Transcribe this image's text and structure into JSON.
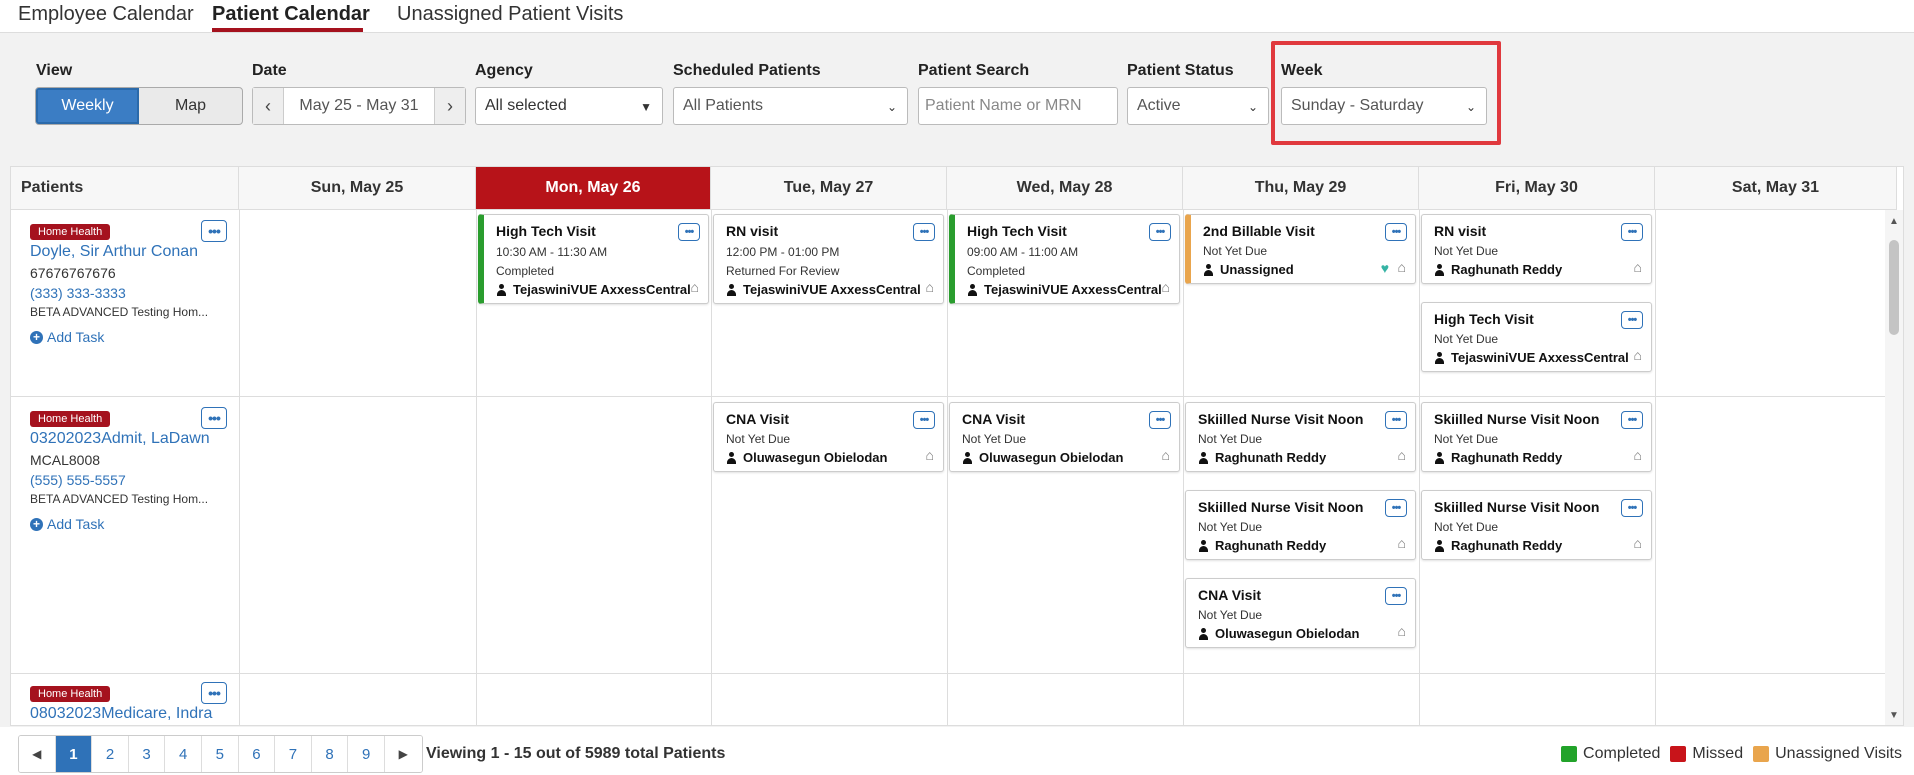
{
  "tabs": [
    {
      "label": "Employee Calendar"
    },
    {
      "label": "Patient Calendar"
    },
    {
      "label": "Unassigned Patient Visits"
    }
  ],
  "filters": {
    "view": {
      "label": "View",
      "options": [
        "Weekly",
        "Map"
      ],
      "selected": "Weekly"
    },
    "date": {
      "label": "Date",
      "value": "May 25 - May 31"
    },
    "agency": {
      "label": "Agency",
      "value": "All selected"
    },
    "scheduled_patients": {
      "label": "Scheduled Patients",
      "value": "All Patients"
    },
    "patient_search": {
      "label": "Patient Search",
      "placeholder": "Patient Name or MRN"
    },
    "patient_status": {
      "label": "Patient Status",
      "value": "Active"
    },
    "week": {
      "label": "Week",
      "value": "Sunday - Saturday"
    }
  },
  "calendar": {
    "patients_header": "Patients",
    "days": [
      {
        "label": "Sun, May 25",
        "today": false
      },
      {
        "label": "Mon, May 26",
        "today": true
      },
      {
        "label": "Tue, May 27",
        "today": false
      },
      {
        "label": "Wed, May 28",
        "today": false
      },
      {
        "label": "Thu, May 29",
        "today": false
      },
      {
        "label": "Fri, May 30",
        "today": false
      },
      {
        "label": "Sat, May 31",
        "today": false
      }
    ],
    "patients": [
      {
        "badge": "Home Health",
        "name": "Doyle, Sir Arthur Conan",
        "mrn": "67676767676",
        "phone": "(333) 333-3333",
        "agency": "BETA ADVANCED Testing Hom...",
        "add_task": "Add Task",
        "visits": [
          {
            "title": "High Tech Visit",
            "time": "10:30 AM - 11:30 AM",
            "status": "Completed",
            "assignee": "TejaswiniVUE AxxessCentral",
            "color": "#2a9d2e"
          },
          {
            "title": "RN visit",
            "time": "12:00 PM - 01:00 PM",
            "status": "Returned For Review",
            "assignee": "TejaswiniVUE AxxessCentral",
            "color": ""
          },
          {
            "title": "High Tech Visit",
            "time": "09:00 AM - 11:00 AM",
            "status": "Completed",
            "assignee": "TejaswiniVUE AxxessCentral",
            "color": "#2a9d2e"
          },
          {
            "title": "2nd Billable Visit",
            "status": "Not Yet Due",
            "assignee": "Unassigned",
            "color": "#e9a54d"
          },
          {
            "title": "RN visit",
            "status": "Not Yet Due",
            "assignee": "Raghunath Reddy",
            "color": ""
          },
          {
            "title": "High Tech Visit",
            "status": "Not Yet Due",
            "assignee": "TejaswiniVUE AxxessCentral",
            "color": ""
          }
        ]
      },
      {
        "badge": "Home Health",
        "name": "03202023Admit, LaDawn",
        "mrn": "MCAL8008",
        "phone": "(555) 555-5557",
        "agency": "BETA ADVANCED Testing Hom...",
        "add_task": "Add Task",
        "visits": [
          {
            "title": "CNA Visit",
            "status": "Not Yet Due",
            "assignee": "Oluwasegun Obielodan",
            "color": ""
          },
          {
            "title": "CNA Visit",
            "status": "Not Yet Due",
            "assignee": "Oluwasegun Obielodan",
            "color": ""
          },
          {
            "title": "Skiilled Nurse Visit Noon",
            "status": "Not Yet Due",
            "assignee": "Raghunath Reddy",
            "color": ""
          },
          {
            "title": "Skiilled Nurse Visit Noon",
            "status": "Not Yet Due",
            "assignee": "Raghunath Reddy",
            "color": ""
          },
          {
            "title": "CNA Visit",
            "status": "Not Yet Due",
            "assignee": "Oluwasegun Obielodan",
            "color": ""
          },
          {
            "title": "Skiilled Nurse Visit Noon",
            "status": "Not Yet Due",
            "assignee": "Raghunath Reddy",
            "color": ""
          },
          {
            "title": "Skiilled Nurse Visit Noon",
            "status": "Not Yet Due",
            "assignee": "Raghunath Reddy",
            "color": ""
          }
        ]
      },
      {
        "badge": "Home Health",
        "name": "08032023Medicare, Indra"
      }
    ]
  },
  "pagination": {
    "pages": [
      "1",
      "2",
      "3",
      "4",
      "5",
      "6",
      "7",
      "8",
      "9"
    ],
    "active_page": "1",
    "viewing": "Viewing 1 - 15 out of 5989 total Patients"
  },
  "legend": [
    {
      "label": "Completed",
      "color": "#22a32a"
    },
    {
      "label": "Missed",
      "color": "#c8141a"
    },
    {
      "label": "Unassigned Visits",
      "color": "#e9a54d"
    }
  ]
}
